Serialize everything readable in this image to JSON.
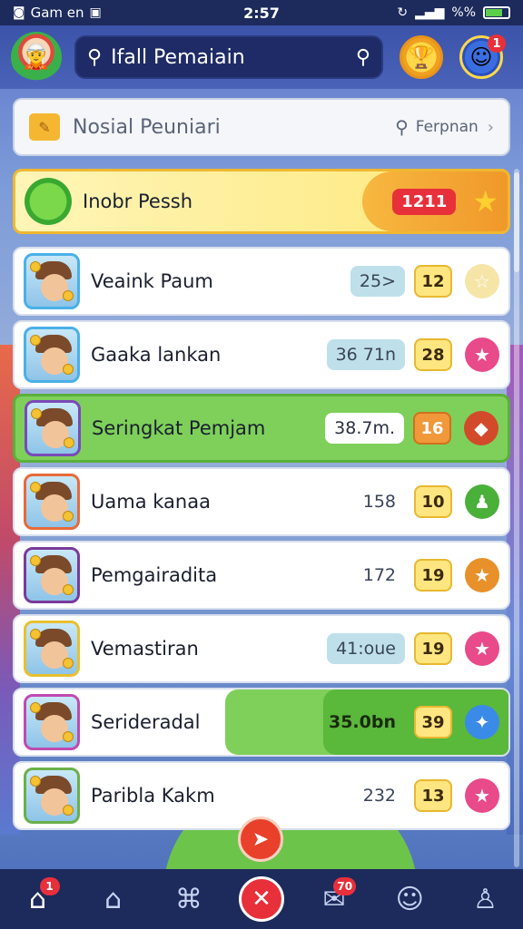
{
  "status_bar": {
    "carrier": "Gam en",
    "time": "2:57",
    "battery": "%%"
  },
  "header": {
    "search_text": "Ifall Pemaiain",
    "profile_badge": "1"
  },
  "sub_search": {
    "title": "Nosial Peuniari",
    "right_label": "Ferpnan"
  },
  "top_row": {
    "name": "Inobr Pessh",
    "score": "1211"
  },
  "rows": [
    {
      "name": "Veaink Paum",
      "value": "25>",
      "level": "12",
      "reward_color": "#f5e6a8",
      "reward_icon": "☆",
      "pill": true
    },
    {
      "name": "Gaaka lankan",
      "value": "36 71n",
      "level": "28",
      "reward_color": "#e84a8a",
      "reward_icon": "★",
      "pill": true
    },
    {
      "name": "Seringkat Pemjam",
      "value": "38.7m.",
      "level": "16",
      "reward_color": "#d24a2a",
      "reward_icon": "◆",
      "highlight": true
    },
    {
      "name": "Uama kanaa",
      "value": "158",
      "level": "10",
      "reward_color": "#4ab03a",
      "reward_icon": "♟"
    },
    {
      "name": "Pemgairadita",
      "value": "172",
      "level": "19",
      "reward_color": "#e8902a",
      "reward_icon": "★"
    },
    {
      "name": "Vemastiran",
      "value": "41:oue",
      "level": "19",
      "reward_color": "#e84a8a",
      "reward_icon": "★",
      "pill": true
    },
    {
      "name": "Serideradal",
      "value": "35.0bn",
      "level": "39",
      "reward_color": "#3a8ae8",
      "reward_icon": "✦",
      "green_band": true
    },
    {
      "name": "Paribla  Kakm",
      "value": "232",
      "level": "13",
      "reward_color": "#e84a8a",
      "reward_icon": "★"
    }
  ],
  "bottom_nav": {
    "home_badge": "1",
    "messages_badge": "70"
  },
  "icons": {
    "logo": "character-logo-icon",
    "search": "search-icon",
    "trophy": "trophy-icon",
    "profile": "profile-icon",
    "folder": "folder-icon",
    "star": "star-icon",
    "fab": "send-icon"
  },
  "colors": {
    "nav_bg": "#1c2a5c",
    "header_bg": "#3b53a8",
    "highlight_green": "#7ed05a",
    "top_yellow": "#fde87a",
    "badge_red": "#e8303a"
  }
}
